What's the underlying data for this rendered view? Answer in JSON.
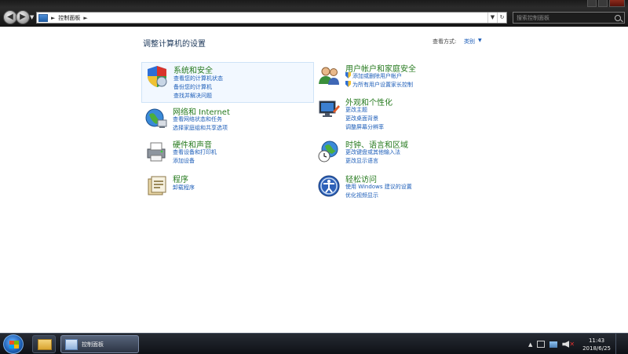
{
  "window": {
    "controls": [
      "minimize",
      "maximize",
      "close"
    ]
  },
  "nav": {
    "address_text": "控制面板",
    "search_placeholder": "搜索控制面板"
  },
  "header": {
    "page_title": "调整计算机的设置",
    "view_by_label": "查看方式:",
    "view_by_value": "类别"
  },
  "categories": {
    "system": {
      "title": "系统和安全",
      "links": [
        "查看您的计算机状态",
        "备份您的计算机",
        "查找并解决问题"
      ]
    },
    "network": {
      "title": "网络和 Internet",
      "links": [
        "查看网络状态和任务",
        "选择家庭组和共享选项"
      ]
    },
    "hardware": {
      "title": "硬件和声音",
      "links": [
        "查看设备和打印机",
        "添加设备"
      ]
    },
    "programs": {
      "title": "程序",
      "links": [
        "卸载程序"
      ]
    },
    "users": {
      "title": "用户帐户和家庭安全",
      "links": [
        "添加或删除用户帐户",
        "为所有用户设置家长控制"
      ]
    },
    "appearance": {
      "title": "外观和个性化",
      "links": [
        "更改主题",
        "更改桌面背景",
        "调整屏幕分辨率"
      ]
    },
    "clock": {
      "title": "时钟、语言和区域",
      "links": [
        "更改键盘或其他输入法",
        "更改显示语言"
      ]
    },
    "ease": {
      "title": "轻松访问",
      "links": [
        "使用 Windows 建议的设置",
        "优化视频显示"
      ]
    }
  },
  "taskbar": {
    "active_app_label": "控制面板",
    "time": "11:43",
    "date": "2018/6/25"
  },
  "colors": {
    "category_title": "#267a1e",
    "link": "#1c5db8",
    "page_title": "#1e395b"
  }
}
